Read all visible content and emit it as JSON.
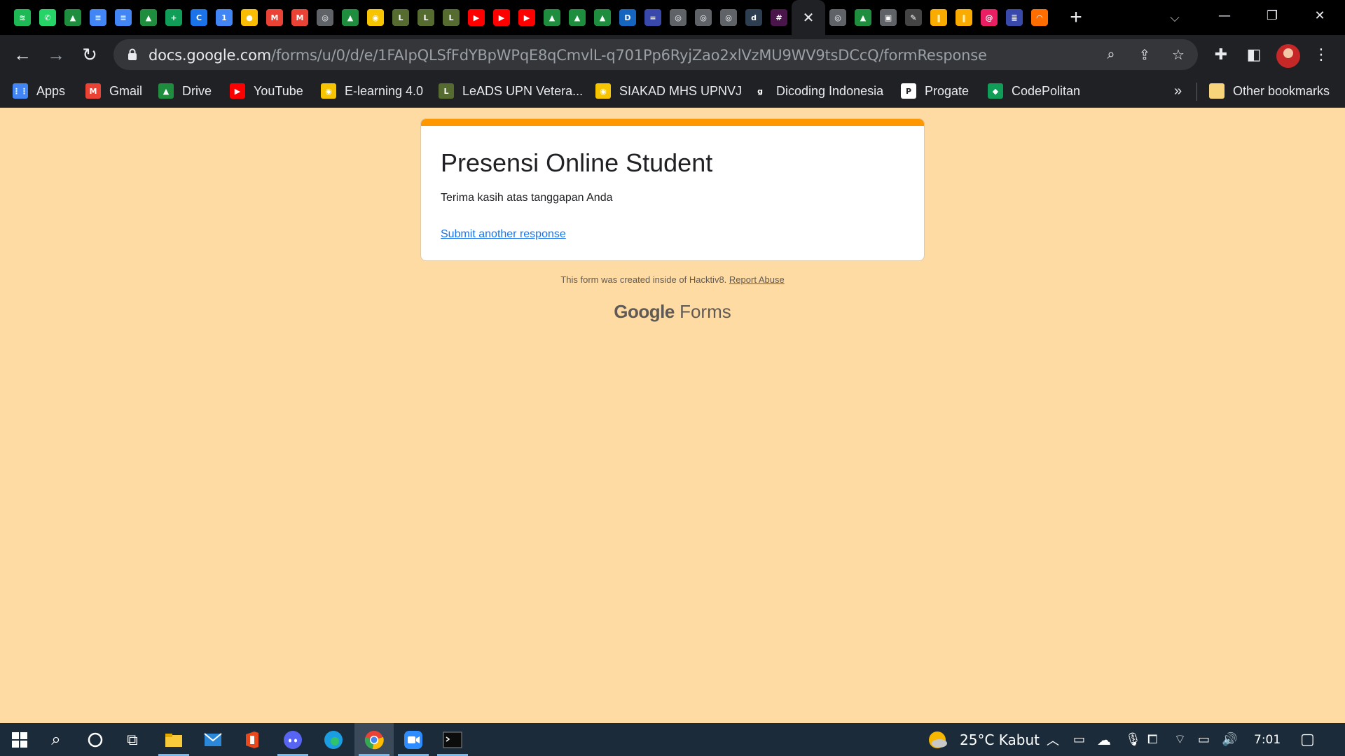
{
  "browser": {
    "tabs": [
      {
        "icon": "spotify-icon",
        "color": "#1db954",
        "glyph": "≋"
      },
      {
        "icon": "whatsapp-icon",
        "color": "#25d366",
        "glyph": "✆"
      },
      {
        "icon": "google-drive-icon",
        "color": "#1e8e3e",
        "glyph": "▲"
      },
      {
        "icon": "google-docs-icon",
        "color": "#4285f4",
        "glyph": "≡"
      },
      {
        "icon": "google-docs-icon",
        "color": "#4285f4",
        "glyph": "≡"
      },
      {
        "icon": "google-drive-icon",
        "color": "#1e8e3e",
        "glyph": "▲"
      },
      {
        "icon": "google-sheets-plus-icon",
        "color": "#0f9d58",
        "glyph": "+"
      },
      {
        "icon": "copyleaks-icon",
        "color": "#1a73e8",
        "glyph": "C"
      },
      {
        "icon": "calendar-icon",
        "color": "#4285f4",
        "glyph": "1"
      },
      {
        "icon": "google-keep-icon",
        "color": "#fbbc04",
        "glyph": "●"
      },
      {
        "icon": "gmail-icon",
        "color": "#ea4335",
        "glyph": "M"
      },
      {
        "icon": "gmail-icon",
        "color": "#ea4335",
        "glyph": "M"
      },
      {
        "icon": "globe-icon",
        "color": "#5f6368",
        "glyph": "◎"
      },
      {
        "icon": "google-drive-icon",
        "color": "#1e8e3e",
        "glyph": "▲"
      },
      {
        "icon": "upnvj-icon",
        "color": "#f6c400",
        "glyph": "◉"
      },
      {
        "icon": "leads-upnvj-icon",
        "color": "#556b2f",
        "glyph": "L"
      },
      {
        "icon": "leads-upnvj-icon",
        "color": "#556b2f",
        "glyph": "L"
      },
      {
        "icon": "leads-upnvj-icon",
        "color": "#556b2f",
        "glyph": "L"
      },
      {
        "icon": "youtube-icon",
        "color": "#ff0000",
        "glyph": "▶"
      },
      {
        "icon": "youtube-icon",
        "color": "#ff0000",
        "glyph": "▶"
      },
      {
        "icon": "youtube-icon",
        "color": "#ff0000",
        "glyph": "▶"
      },
      {
        "icon": "google-drive-icon",
        "color": "#1e8e3e",
        "glyph": "▲"
      },
      {
        "icon": "google-drive-icon",
        "color": "#1e8e3e",
        "glyph": "▲"
      },
      {
        "icon": "google-drive-icon",
        "color": "#1e8e3e",
        "glyph": "▲"
      },
      {
        "icon": "dp-icon",
        "color": "#1565c0",
        "glyph": "D"
      },
      {
        "icon": "site-icon",
        "color": "#3949ab",
        "glyph": "="
      },
      {
        "icon": "globe-icon",
        "color": "#5f6368",
        "glyph": "◎"
      },
      {
        "icon": "globe-icon",
        "color": "#5f6368",
        "glyph": "◎"
      },
      {
        "icon": "globe-icon",
        "color": "#5f6368",
        "glyph": "◎"
      },
      {
        "icon": "dicoding-icon",
        "color": "#2d3e50",
        "glyph": "d"
      },
      {
        "icon": "slack-icon",
        "color": "#4a154b",
        "glyph": "#"
      }
    ],
    "tabs_after": [
      {
        "icon": "globe-icon",
        "color": "#5f6368",
        "glyph": "◎"
      },
      {
        "icon": "google-drive-icon",
        "color": "#1e8e3e",
        "glyph": "▲"
      },
      {
        "icon": "contacts-icon",
        "color": "#5f6368",
        "glyph": "▣"
      },
      {
        "icon": "pen-icon",
        "color": "#444",
        "glyph": "✎"
      },
      {
        "icon": "bar-chart-icon",
        "color": "#f9ab00",
        "glyph": "‖"
      },
      {
        "icon": "bar-chart-icon",
        "color": "#f9ab00",
        "glyph": "‖"
      },
      {
        "icon": "spiral-icon",
        "color": "#e91e63",
        "glyph": "@"
      },
      {
        "icon": "site-icon",
        "color": "#3949ab",
        "glyph": "≣"
      },
      {
        "icon": "loading-icon",
        "color": "#ff6d00",
        "glyph": "◠"
      }
    ],
    "active_tab_glyph": "✕",
    "new_tab_glyph": "+",
    "url_host": "docs.google.com",
    "url_path": "/forms/u/0/d/e/1FAIpQLSfFdYBpWPqE8qCmvlL-q701Pp6RyjZao2xlVzMU9WV9tsDCcQ/formResponse"
  },
  "bookmarks": [
    {
      "label": "Apps",
      "icon": "apps-grid-icon",
      "color": "#4285f4",
      "glyph": "⋮⋮"
    },
    {
      "label": "Gmail",
      "icon": "gmail-icon",
      "color": "#ea4335",
      "glyph": "M"
    },
    {
      "label": "Drive",
      "icon": "google-drive-icon",
      "color": "#1e8e3e",
      "glyph": "▲"
    },
    {
      "label": "YouTube",
      "icon": "youtube-icon",
      "color": "#ff0000",
      "glyph": "▶"
    },
    {
      "label": "E-learning 4.0",
      "icon": "upnvj-icon",
      "color": "#f6c400",
      "glyph": "◉"
    },
    {
      "label": "LeADS UPN Vetera...",
      "icon": "leads-upnvj-icon",
      "color": "#556b2f",
      "glyph": "L"
    },
    {
      "label": "SIAKAD MHS UPNVJ",
      "icon": "upnvj-icon",
      "color": "#f6c400",
      "glyph": "◉"
    },
    {
      "label": "Dicoding Indonesia",
      "icon": "dicoding-icon",
      "color": "#202124",
      "glyph": "g"
    },
    {
      "label": "Progate",
      "icon": "progate-icon",
      "color": "#ffffff",
      "glyph": "P"
    },
    {
      "label": "CodePolitan",
      "icon": "codepolitan-icon",
      "color": "#0f9d58",
      "glyph": "◆"
    }
  ],
  "bookmarks_more": "»",
  "other_bookmarks": "Other bookmarks",
  "form": {
    "title": "Presensi Online Student",
    "message": "Terima kasih atas tanggapan Anda",
    "submit_another": "Submit another response",
    "footer_text": "This form was created inside of Hacktiv8. ",
    "report_abuse": "Report Abuse",
    "logo_google": "Google",
    "logo_forms": "Forms",
    "accent_color": "#ff9800",
    "background_color": "#ffdba4"
  },
  "taskbar": {
    "weather": "25°C  Kabut",
    "time": "7:01"
  }
}
